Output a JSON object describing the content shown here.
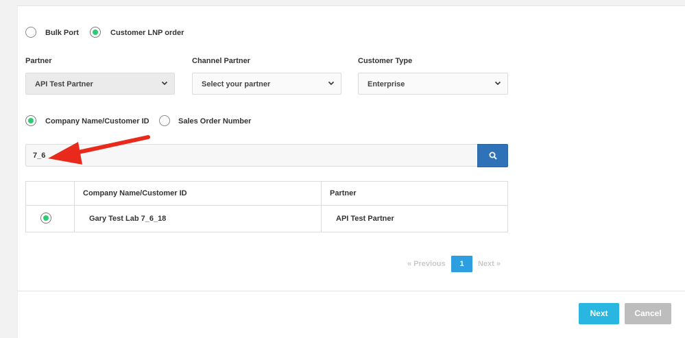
{
  "order_type": {
    "options": [
      "Bulk Port",
      "Customer LNP order"
    ],
    "selected": "Customer LNP order"
  },
  "filters": {
    "partner": {
      "label": "Partner",
      "value": "API Test Partner"
    },
    "channel_partner": {
      "label": "Channel Partner",
      "value": "Select your partner"
    },
    "customer_type": {
      "label": "Customer Type",
      "value": "Enterprise"
    }
  },
  "search_mode": {
    "options": [
      "Company Name/Customer ID",
      "Sales Order Number"
    ],
    "selected": "Company Name/Customer ID"
  },
  "search": {
    "value": "7_6",
    "button_icon": "search-icon"
  },
  "results": {
    "columns": [
      "",
      "Company Name/Customer ID",
      "Partner"
    ],
    "rows": [
      {
        "selected": true,
        "company": "Gary Test Lab 7_6_18",
        "partner": "API Test Partner"
      }
    ]
  },
  "pagination": {
    "previous": "« Previous",
    "current": "1",
    "next": "Next »"
  },
  "actions": {
    "next": "Next",
    "cancel": "Cancel"
  },
  "annotation": {
    "type": "red-arrow",
    "points_to": "search-input"
  },
  "colors": {
    "radio_checked": "#2ecc71",
    "search_button": "#2f72b7",
    "page_active": "#2d9ee0",
    "next_button": "#29b6e0",
    "cancel_button": "#bdbdbd",
    "arrow": "#e8291c"
  }
}
